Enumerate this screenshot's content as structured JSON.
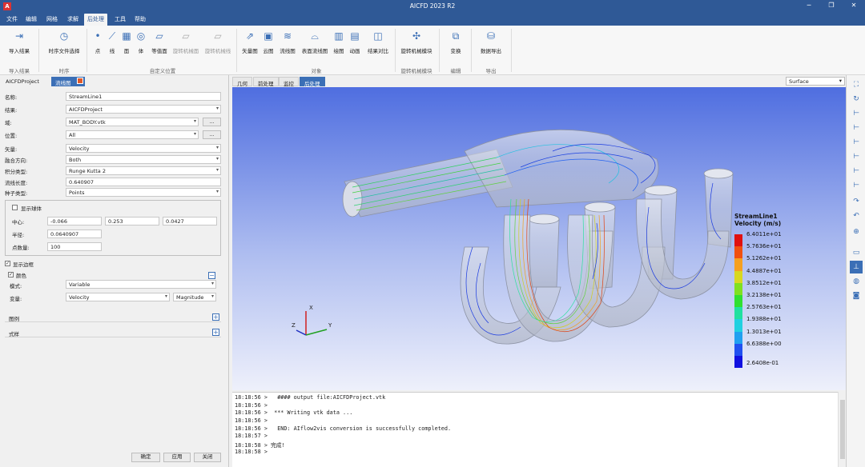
{
  "app": {
    "title": "AICFD 2023 R2",
    "logo_text": "A"
  },
  "menu": [
    "文件",
    "编辑",
    "网格",
    "求解",
    "后处理",
    "工具",
    "帮助"
  ],
  "menu_active": "后处理",
  "ribbon": {
    "import_result": "导入结果",
    "group_import": "导入结果",
    "timestep_select": "时序文件选择",
    "group_time": "时序",
    "point": "点",
    "line": "线",
    "plane": "面",
    "body": "体",
    "iso": "等值面",
    "rot_plane": "旋转机械面",
    "rot_line": "旋转机械线",
    "group_custom": "自定义位置",
    "vector": "矢量图",
    "contour": "云图",
    "streamline": "流线图",
    "surface_stream": "表面流线图",
    "graph": "绘图",
    "animation": "动画",
    "compare": "结果对比",
    "group_object": "对象",
    "rot_module": "旋转机械模块",
    "group_rot": "旋转机械模块",
    "transform": "变换",
    "group_edit": "编辑",
    "data_export": "数据导出",
    "group_export": "导出"
  },
  "left_tabs": {
    "project": "AICFDProject",
    "stream": "流线图"
  },
  "form": {
    "name_label": "名称:",
    "name": "StreamLine1",
    "result_label": "结果:",
    "result": "AICFDProject",
    "domain_label": "域:",
    "domain": "MAT_BODY.vtk",
    "domain_btn": "...",
    "location_label": "位置:",
    "location": "All",
    "location_btn": "...",
    "vector_label": "矢量:",
    "vector": "Velocity",
    "direction_label": "融合方向:",
    "direction": "Both",
    "integrator_label": "积分类型:",
    "integrator": "Runge Kutta 2",
    "length_label": "流线长度:",
    "length": "0.640907",
    "seed_label": "种子类型:",
    "seed": "Points",
    "show_sphere": "显示球体",
    "center_label": "中心:",
    "cx": "-0.066",
    "cy": "0.253",
    "cz": "0.0427",
    "radius_label": "半径:",
    "radius": "0.0640907",
    "npoints_label": "点数量:",
    "npoints": "100",
    "show_edges": "显示边框",
    "color_label": "颜色",
    "mode_label": "模式:",
    "mode": "Variable",
    "variable_label": "变量:",
    "variable": "Velocity",
    "component": "Magnitude",
    "legend_label": "图例",
    "style_label": "式样",
    "ok": "确定",
    "apply": "应用",
    "close": "关闭"
  },
  "view_tabs": [
    "几何",
    "前处理",
    "监控",
    "后处理"
  ],
  "view_tab_active": "后处理",
  "surface_mode": "Surface",
  "axes": {
    "x": "X",
    "y": "Y",
    "z": "Z"
  },
  "legend": {
    "title_line1": "StreamLine1",
    "title_line2": "Velocity (m/s)",
    "values": [
      "6.4011e+01",
      "5.7636e+01",
      "5.1262e+01",
      "4.4887e+01",
      "3.8512e+01",
      "3.2138e+01",
      "2.5763e+01",
      "1.9388e+01",
      "1.3013e+01",
      "6.6388e+00",
      "2.6408e-01"
    ],
    "colors": [
      "#e01010",
      "#f05010",
      "#f5a020",
      "#d8d820",
      "#80e020",
      "#30e030",
      "#20e0a0",
      "#20d0e0",
      "#20a0f0",
      "#2050f0",
      "#1010e0"
    ]
  },
  "console": [
    "18:18:56 >   #### output file:AICFDProject.vtk",
    "18:18:56 >",
    "18:18:56 >  *** Writing vtk data ...",
    "18:18:56 >",
    "18:18:56 >   END: AIflow2vis conversion is successfully completed.",
    "18:18:57 >",
    "18:18:58 > 完成!",
    "18:18:58 >"
  ]
}
